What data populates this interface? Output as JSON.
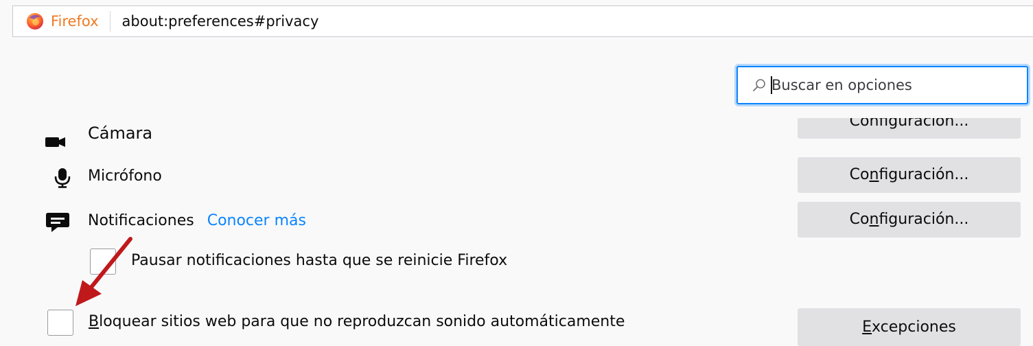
{
  "urlbar": {
    "browser_name": "Firefox",
    "url": "about:preferences#privacy",
    "logo_icon": "firefox-logo"
  },
  "search": {
    "placeholder": "Buscar en opciones",
    "icon": "search-icon"
  },
  "permissions": {
    "camera": {
      "label": "Cámara",
      "button": "Configuración..."
    },
    "microphone": {
      "label": "Micrófono",
      "button_prefix": "Co",
      "button_mnemonic": "n",
      "button_suffix": "figuración..."
    },
    "notifications": {
      "label": "Notificaciones",
      "link": "Conocer más",
      "button_prefix": "Co",
      "button_mnemonic": "n",
      "button_suffix": "figuración...",
      "pause_checkbox_label": "Pausar notificaciones hasta que se reinicie Firefox",
      "pause_checked": false
    },
    "autoplay": {
      "label_mnemonic": "B",
      "label_rest": "loquear sitios web para que no reproduzcan sonido automáticamente",
      "checked": false,
      "button_mnemonic": "E",
      "button_rest": "xcepciones"
    }
  },
  "colors": {
    "accent": "#0a84ff",
    "firefox_orange": "#f07a23",
    "button_bg": "#e1e1e4",
    "annotation_arrow": "#c0191c"
  }
}
